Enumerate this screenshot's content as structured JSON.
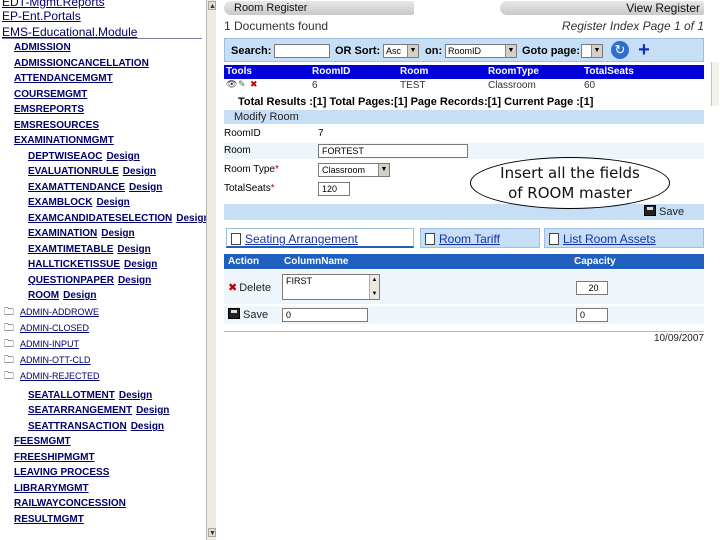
{
  "nav": {
    "top_links": [
      "EDT-Mgmt.Reports",
      "EP-Ent.Portals",
      "EMS-Educational.Module"
    ],
    "modules": [
      {
        "label": "ADMISSION"
      },
      {
        "label": "ADMISSIONCANCELLATION"
      },
      {
        "label": "ATTENDANCEMGMT"
      },
      {
        "label": "COURSEMGMT"
      },
      {
        "label": "EMSREPORTS"
      },
      {
        "label": "EMSRESOURCES"
      },
      {
        "label": "EXAMINATIONMGMT"
      }
    ],
    "exam_children": [
      {
        "label": "DEPTWISEAOC",
        "design": "Design"
      },
      {
        "label": "EVALUATIONRULE",
        "design": "Design"
      },
      {
        "label": "EXAMATTENDANCE",
        "design": "Design"
      },
      {
        "label": "EXAMBLOCK",
        "design": "Design"
      },
      {
        "label": "EXAMCANDIDATESELECTION",
        "design": "Design"
      },
      {
        "label": "EXAMINATION",
        "design": "Design"
      },
      {
        "label": "EXAMTIMETABLE",
        "design": "Design"
      },
      {
        "label": "HALLTICKETISSUE",
        "design": "Design"
      },
      {
        "label": "QUESTIONPAPER",
        "design": "Design"
      },
      {
        "label": "ROOM",
        "design": "Design"
      }
    ],
    "admin_folders": [
      "ADMIN-ADDROWE",
      "ADMIN-CLOSED",
      "ADMIN-INPUT",
      "ADMIN-OTT-CLD",
      "ADMIN-REJECTED"
    ],
    "seat_children": [
      {
        "label": "SEATALLOTMENT",
        "design": "Design"
      },
      {
        "label": "SEATARRANGEMENT",
        "design": "Design"
      },
      {
        "label": "SEATTRANSACTION",
        "design": "Design"
      }
    ],
    "modules_bottom": [
      "FEESMGMT",
      "FREESHIPMGMT",
      "LEAVING PROCESS",
      "LIBRARYMGMT",
      "RAILWAYCONCESSION",
      "RESULTMGMT"
    ]
  },
  "tabs": {
    "room_register": "Room Register",
    "view_register": "View Register"
  },
  "register": {
    "docs_found": "1 Documents found",
    "index": "Register Index Page 1 of 1"
  },
  "search": {
    "search_label": "Search:",
    "search_value": "",
    "or_sort_label": "OR Sort:",
    "sort_value": "Asc",
    "on_label": "on:",
    "on_value": "RoomID",
    "goto_label": "Goto page:",
    "goto_value": ""
  },
  "list": {
    "headers": [
      "Tools",
      "RoomID",
      "Room",
      "RoomType",
      "TotalSeats"
    ],
    "row": {
      "room_id": "6",
      "room": "TEST",
      "room_type": "Classroom",
      "total_seats": "60"
    }
  },
  "totals": {
    "results": "Total Results :[1]",
    "pages": "Total Pages:[1]",
    "records": "Page Records:[1]",
    "current": "Current Page :[1]"
  },
  "form": {
    "title": "Modify Room",
    "room_id_label": "RoomID",
    "room_id_value": "7",
    "room_label": "Room",
    "room_value": "FORTEST",
    "room_type_label": "Room Type",
    "room_type_value": "Classroom",
    "total_seats_label": "TotalSeats",
    "total_seats_value": "120",
    "save_label": "Save"
  },
  "callout": {
    "line1": "Insert all the fields",
    "line2": "of ROOM master"
  },
  "subtabs": [
    "Seating Arrangement",
    "Room Tariff",
    "List Room Assets"
  ],
  "seating": {
    "headers": {
      "action": "Action",
      "column_name": "ColumnName",
      "capacity": "Capacity"
    },
    "row1": {
      "column_value": "FIRST",
      "capacity_value": "20",
      "action": "Delete"
    },
    "row2": {
      "column_value": "0",
      "capacity_value": "0",
      "action": "Save"
    }
  },
  "footer": {
    "date": "10/09/2007"
  },
  "colors": {
    "accent": "#0000d8",
    "light_blue": "#c6dff7",
    "nav_text": "#00006b"
  }
}
